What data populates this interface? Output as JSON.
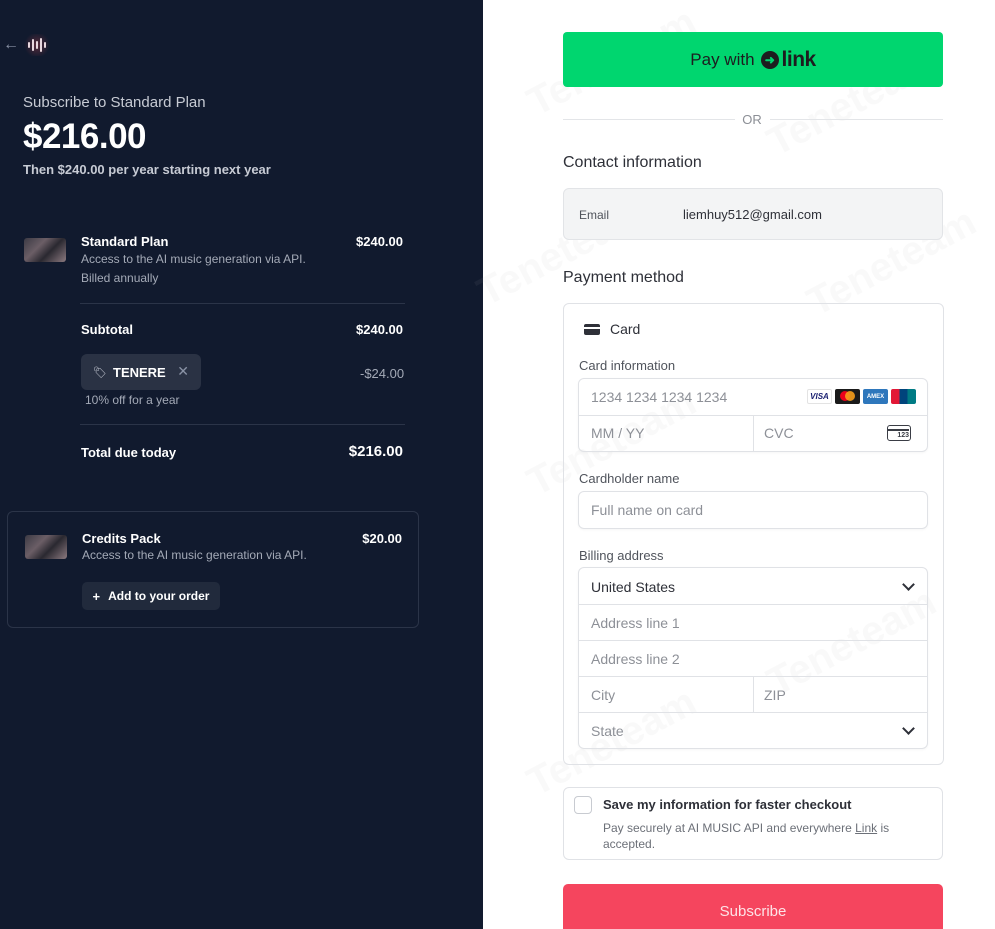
{
  "summary": {
    "subscribe_title": "Subscribe to Standard Plan",
    "price": "$216.00",
    "then_text": "Then $240.00 per year starting next year"
  },
  "items": [
    {
      "name": "Standard Plan",
      "desc": "Access to the AI music generation via API.",
      "billing": "Billed annually",
      "price": "$240.00"
    }
  ],
  "subtotal": {
    "label": "Subtotal",
    "value": "$240.00"
  },
  "coupon": {
    "code": "TENERE",
    "discount": "-$24.00",
    "note": "10% off for a year"
  },
  "total": {
    "label": "Total due today",
    "value": "$216.00"
  },
  "upsell": {
    "name": "Credits Pack",
    "desc": "Access to the AI music generation via API.",
    "price": "$20.00",
    "button": "Add to your order"
  },
  "link_button": {
    "prefix": "Pay with",
    "brand": "link"
  },
  "or_text": "OR",
  "contact": {
    "title": "Contact information",
    "email_label": "Email",
    "email_value": "liemhuy512@gmail.com"
  },
  "payment": {
    "title": "Payment method",
    "card_label": "Card",
    "card_info_label": "Card information",
    "card_number_placeholder": "1234 1234 1234 1234",
    "expiry_placeholder": "MM / YY",
    "cvc_placeholder": "CVC",
    "cardholder_label": "Cardholder name",
    "cardholder_placeholder": "Full name on card",
    "billing_label": "Billing address",
    "country_value": "United States",
    "address1_placeholder": "Address line 1",
    "address2_placeholder": "Address line 2",
    "city_placeholder": "City",
    "zip_placeholder": "ZIP",
    "state_placeholder": "State",
    "brands": [
      "VISA",
      "Mastercard",
      "AMEX",
      "UnionPay"
    ]
  },
  "save_info": {
    "title": "Save my information for faster checkout",
    "desc_prefix": "Pay securely at AI MUSIC API and everywhere ",
    "desc_link": "Link",
    "desc_suffix": " is accepted."
  },
  "subscribe_button": "Subscribe",
  "watermark": "Teneteam",
  "colors": {
    "left_bg": "#111a2e",
    "link_green": "#00d66f",
    "subscribe_red": "#f5455e"
  }
}
